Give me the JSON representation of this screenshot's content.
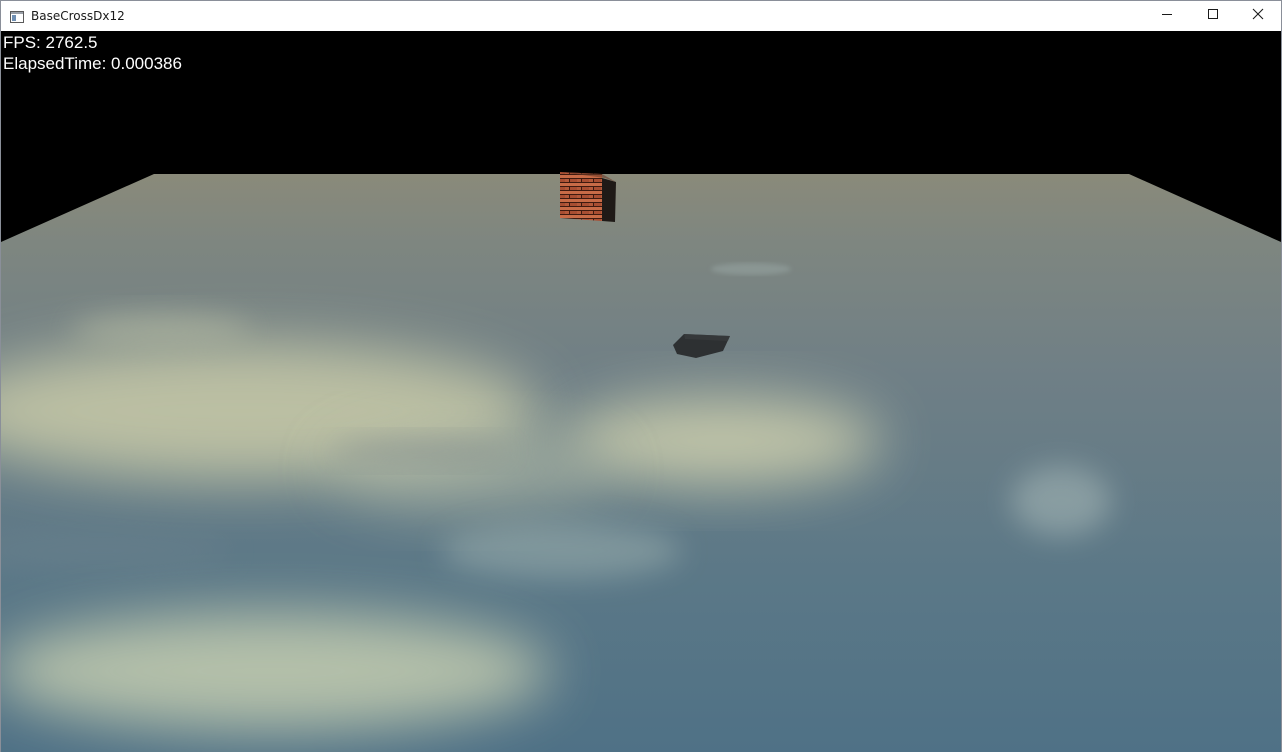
{
  "window": {
    "title": "BaseCrossDx12",
    "icons": {
      "app": "app-window-icon",
      "minimize": "minimize-icon",
      "maximize": "maximize-icon",
      "close": "close-icon"
    }
  },
  "hud": {
    "fps_text": "FPS: 2762.5",
    "elapsed_text": "ElapsedTime: 0.000386"
  },
  "scene": {
    "background_color": "#000000",
    "ground": "cloud-textured plane",
    "objects": [
      "brick-textured cube",
      "dark box shadow"
    ]
  }
}
